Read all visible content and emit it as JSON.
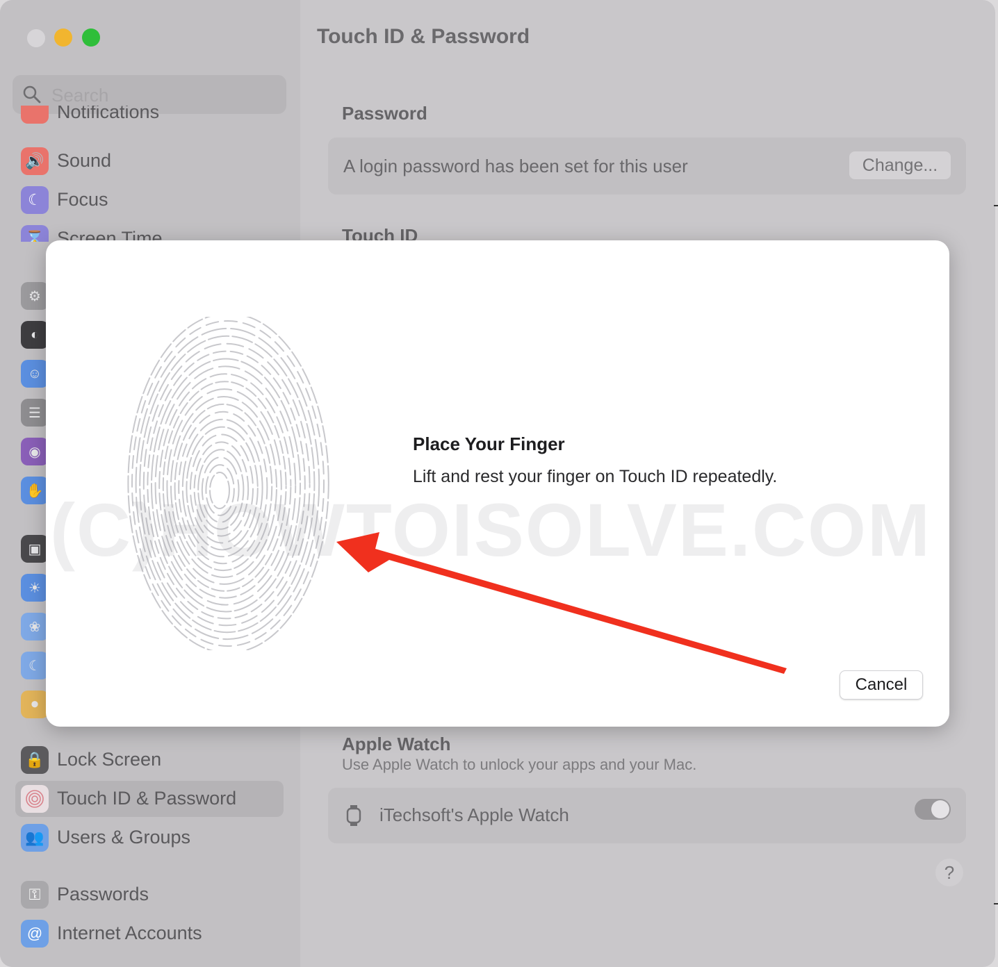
{
  "window": {
    "title": "Touch ID & Password"
  },
  "search": {
    "placeholder": "Search"
  },
  "sidebar": {
    "items": [
      {
        "label": "Notifications",
        "icon": "bell-icon",
        "color": "#e9736b"
      },
      {
        "label": "Sound",
        "icon": "speaker-icon",
        "color": "#e9736b"
      },
      {
        "label": "Focus",
        "icon": "moon-icon",
        "color": "#8c84d8"
      },
      {
        "label": "Screen Time",
        "icon": "hourglass-icon",
        "color": "#8c84d8"
      },
      {
        "label": "Lock Screen",
        "icon": "lock-icon",
        "color": "#5b5a5d"
      },
      {
        "label": "Touch ID & Password",
        "icon": "fingerprint-icon",
        "color": "#e6a3a8",
        "selected": true
      },
      {
        "label": "Users & Groups",
        "icon": "users-icon",
        "color": "#6ea0e6"
      },
      {
        "label": "Passwords",
        "icon": "key-icon",
        "color": "#a9a8ab"
      },
      {
        "label": "Internet Accounts",
        "icon": "at-icon",
        "color": "#6ea0e6"
      }
    ]
  },
  "main": {
    "password_section": {
      "title": "Password",
      "text": "A login password has been set for this user",
      "button": "Change..."
    },
    "touchid_section": {
      "title": "Touch ID"
    },
    "watch_section": {
      "title": "Apple Watch",
      "subtitle": "Use Apple Watch to unlock your apps and your Mac.",
      "device": "iTechsoft's Apple Watch",
      "toggle_on": true
    },
    "help": "?"
  },
  "dialog": {
    "title": "Place Your Finger",
    "message": "Lift and rest your finger on Touch ID repeatedly.",
    "cancel": "Cancel"
  },
  "watermark": "(C)HOWTOISOLVE.COM",
  "colors": {
    "arrow": "#f0301e",
    "selection": "#b5b3b6"
  }
}
